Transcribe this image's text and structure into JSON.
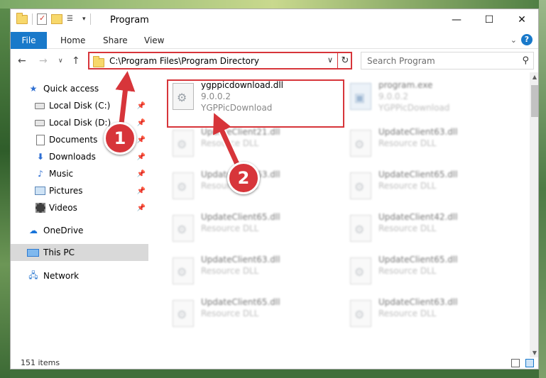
{
  "window": {
    "title": "Program"
  },
  "ribbon": {
    "tabs": [
      "File",
      "Home",
      "Share",
      "View"
    ]
  },
  "address": {
    "path": "C:\\Program Files\\Program Directory"
  },
  "search": {
    "placeholder": "Search Program"
  },
  "sidebar": {
    "items": [
      {
        "label": "Quick access",
        "icon": "star-icon"
      },
      {
        "label": "Local Disk (C:)",
        "icon": "drive-icon"
      },
      {
        "label": "Local Disk (D:)",
        "icon": "drive-icon"
      },
      {
        "label": "Documents",
        "icon": "documents-icon"
      },
      {
        "label": "Downloads",
        "icon": "downloads-icon"
      },
      {
        "label": "Music",
        "icon": "music-icon"
      },
      {
        "label": "Pictures",
        "icon": "pictures-icon"
      },
      {
        "label": "Videos",
        "icon": "videos-icon"
      },
      {
        "label": "OneDrive",
        "icon": "cloud-icon"
      },
      {
        "label": "This PC",
        "icon": "computer-icon"
      },
      {
        "label": "Network",
        "icon": "network-icon"
      }
    ]
  },
  "files": [
    {
      "name": "ygppicdownload.dll",
      "meta1": "9.0.0.2",
      "meta2": "YGPPicDownload"
    },
    {
      "name": "program.exe",
      "meta1": "9.0.0.2",
      "meta2": "YGPPicDownload"
    },
    {
      "name": "UpdateClient21.dll",
      "meta1": "Resource DLL"
    },
    {
      "name": "UpdateClient63.dll",
      "meta1": "Resource DLL"
    },
    {
      "name": "UpdateClient63.dll",
      "meta1": "Resource DLL"
    },
    {
      "name": "UpdateClient65.dll",
      "meta1": "Resource DLL"
    },
    {
      "name": "UpdateClient65.dll",
      "meta1": "Resource DLL"
    },
    {
      "name": "UpdateClient42.dll",
      "meta1": "Resource DLL"
    },
    {
      "name": "UpdateClient63.dll",
      "meta1": "Resource DLL"
    },
    {
      "name": "UpdateClient65.dll",
      "meta1": "Resource DLL"
    },
    {
      "name": "UpdateClient65.dll",
      "meta1": "Resource DLL"
    },
    {
      "name": "UpdateClient63.dll",
      "meta1": "Resource DLL"
    }
  ],
  "status": {
    "count": "151 items"
  },
  "annotations": {
    "step1": "1",
    "step2": "2"
  },
  "colors": {
    "accent": "#1979ca",
    "highlight": "#d7353a"
  }
}
